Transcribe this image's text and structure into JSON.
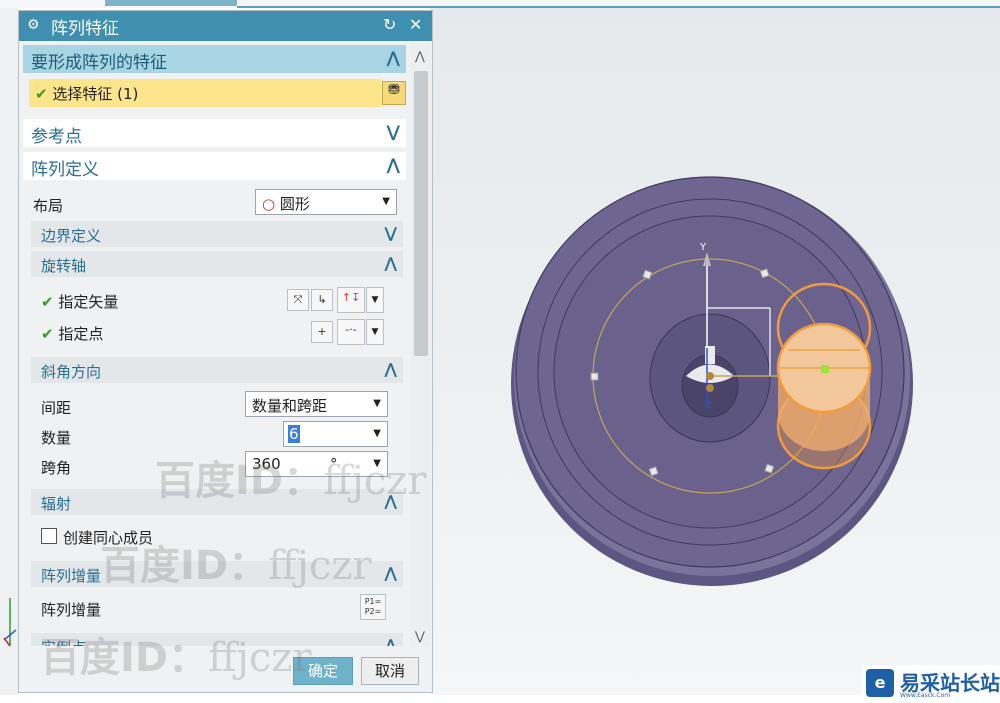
{
  "dialog": {
    "title": "阵列特征",
    "reset_icon": "↻",
    "close_icon": "✕"
  },
  "sections": {
    "features_to_pattern": {
      "title": "要形成阵列的特征",
      "select_label": "选择特征 (1)"
    },
    "reference_point": {
      "title": "参考点"
    },
    "pattern_definition": {
      "title": "阵列定义",
      "layout_label": "布局",
      "layout_value": "圆形",
      "boundary_definition": "边界定义",
      "rotation_axis": {
        "title": "旋转轴",
        "specify_vector": "指定矢量",
        "specify_point": "指定点"
      },
      "angle_direction": {
        "title": "斜角方向",
        "spacing_label": "间距",
        "spacing_value": "数量和跨距",
        "count_label": "数量",
        "count_value": "6",
        "span_label": "跨角",
        "span_value": "360",
        "span_unit": "°"
      },
      "radiation": {
        "title": "辐射",
        "concentric_label": "创建同心成员"
      },
      "pattern_increment": {
        "title": "阵列增量",
        "label": "阵列增量",
        "icon_text": "P1= P2="
      },
      "instance_point": {
        "title": "实例点"
      }
    }
  },
  "buttons": {
    "ok": "确定",
    "cancel": "取消"
  },
  "viewport": {
    "axis_y": "Y",
    "axis_z": "Z"
  },
  "watermarks": {
    "text": "百度ID：",
    "id": "ffjczr"
  },
  "logo": {
    "mark": "e",
    "text": "易采站长站",
    "subtext": "Www.Easck.Com"
  },
  "colors": {
    "title_bar": "#3f8fb0",
    "selected_header": "#a9d4e3",
    "selection_row": "#fde58b",
    "ok_button": "#6fb2cc",
    "part_body": "#6e6690",
    "pattern_highlight": "#f39a3c"
  }
}
